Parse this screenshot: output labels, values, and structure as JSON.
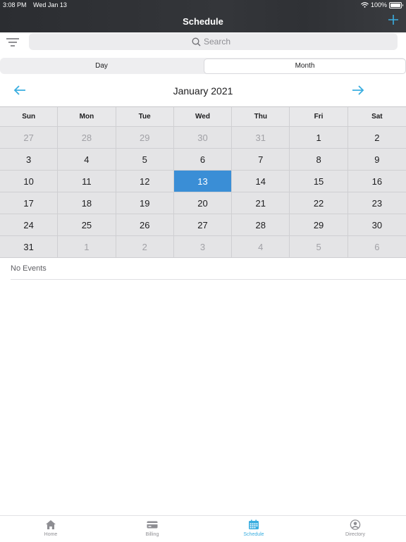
{
  "status_bar": {
    "time": "3:08 PM",
    "date": "Wed Jan 13",
    "battery": "100%"
  },
  "header": {
    "title": "Schedule"
  },
  "search": {
    "placeholder": "Search"
  },
  "view_toggle": {
    "day_label": "Day",
    "month_label": "Month",
    "selected": "Month"
  },
  "calendar": {
    "month_title": "January 2021",
    "weekdays": [
      "Sun",
      "Mon",
      "Tue",
      "Wed",
      "Thu",
      "Fri",
      "Sat"
    ],
    "weeks": [
      [
        "27",
        "28",
        "29",
        "30",
        "31",
        "1",
        "2"
      ],
      [
        "3",
        "4",
        "5",
        "6",
        "7",
        "8",
        "9"
      ],
      [
        "10",
        "11",
        "12",
        "13",
        "14",
        "15",
        "16"
      ],
      [
        "17",
        "18",
        "19",
        "20",
        "21",
        "22",
        "23"
      ],
      [
        "24",
        "25",
        "26",
        "27",
        "28",
        "29",
        "30"
      ],
      [
        "31",
        "1",
        "2",
        "3",
        "4",
        "5",
        "6"
      ]
    ],
    "selected_day": "13"
  },
  "events": {
    "empty_text": "No Events"
  },
  "tab_bar": {
    "home": "Home",
    "billing": "Billing",
    "schedule": "Schedule",
    "directory": "Directory",
    "active": "Schedule"
  },
  "colors": {
    "accent": "#3aaee0",
    "selected_day": "#3a8ed6",
    "header_bg": "#2f3135"
  }
}
